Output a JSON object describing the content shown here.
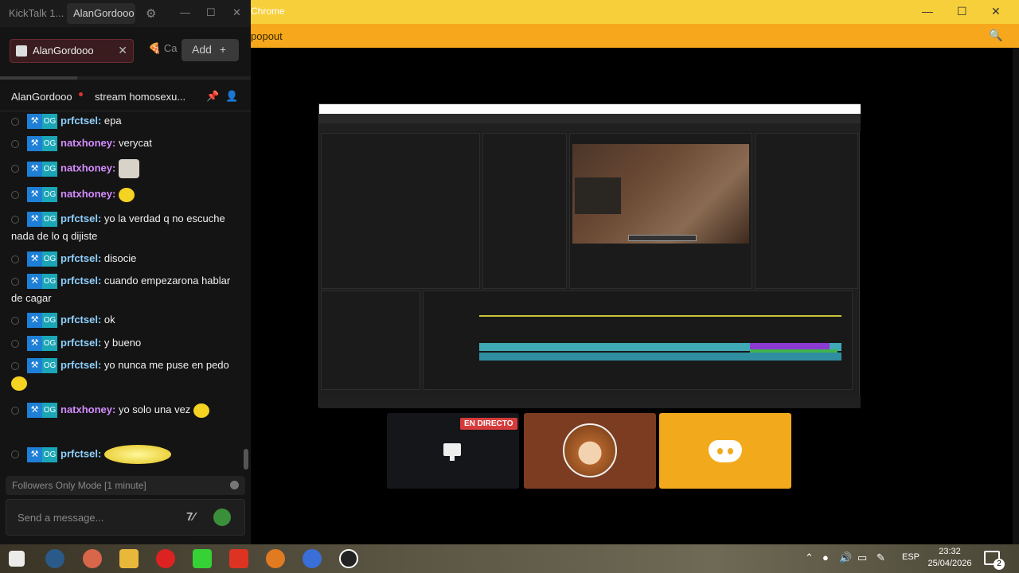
{
  "kicktalk": {
    "app_title": "KickTalk 1...",
    "user_chip": "AlanGordooo",
    "tab_active": "AlanGordooo",
    "tab_other": "Ca",
    "add_label": "Add",
    "add_plus": "+",
    "channel_name": "AlanGordooo",
    "stream_title": "stream homosexu...",
    "follow_mode": "Followers Only Mode [1 minute]",
    "input_placeholder": "Send a message...",
    "messages": [
      {
        "user": "prfctsel:",
        "text": "epa"
      },
      {
        "user": "natxhoney:",
        "text": "verycat"
      },
      {
        "user": "natxhoney:",
        "text": ""
      },
      {
        "user": "natxhoney:",
        "text": ""
      },
      {
        "user": "prfctsel:",
        "text": "yo la verdad q no escuche nada de lo q dijiste"
      },
      {
        "user": "prfctsel:",
        "text": "disocie"
      },
      {
        "user": "prfctsel:",
        "text": "cuando empezarona hablar de cagar"
      },
      {
        "user": "prfctsel:",
        "text": "ok"
      },
      {
        "user": "prfctsel:",
        "text": "y bueno"
      },
      {
        "user": "prfctsel:",
        "text": "yo nunca me puse en pedo"
      },
      {
        "user": "natxhoney:",
        "text": "yo solo una vez"
      },
      {
        "user": "prfctsel:",
        "text": ""
      }
    ]
  },
  "chrome": {
    "title": "Chrome",
    "address": "popout",
    "min": "—",
    "max": "☐",
    "close": "✕"
  },
  "call": {
    "live_badge": "EN DIRECTO"
  },
  "taskbar": {
    "lang": "ESP",
    "time": "23:32",
    "date": "25/04/2026",
    "notifications": "2"
  }
}
